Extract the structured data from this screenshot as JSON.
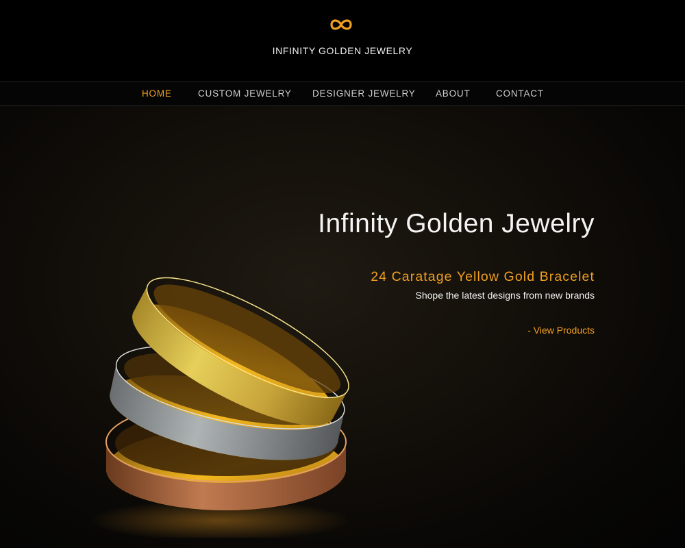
{
  "header": {
    "logo_icon": "infinity-icon",
    "brand_name": "INFINITY GOLDEN JEWELRY",
    "accent_color": "#f0a020"
  },
  "nav": {
    "items": [
      {
        "label": "HOME",
        "active": true
      },
      {
        "label": "CUSTOM JEWELRY",
        "active": false
      },
      {
        "label": "DESIGNER JEWELRY",
        "active": false
      },
      {
        "label": "ABOUT",
        "active": false
      },
      {
        "label": "CONTACT",
        "active": false
      }
    ]
  },
  "hero": {
    "title": "Infinity Golden Jewelry",
    "subtitle": "24 Caratage Yellow Gold Bracelet",
    "description": "Shope the latest designs from new brands",
    "link_label": "- View Products",
    "image": "gold-bracelets-image"
  }
}
